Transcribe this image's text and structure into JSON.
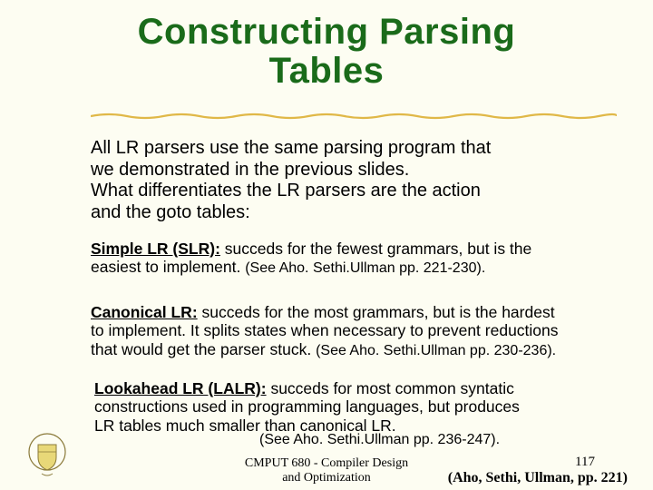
{
  "title_line1": "Constructing Parsing",
  "title_line2": "Tables",
  "intro": {
    "l1": "All LR parsers use the same parsing program that",
    "l2": "we demonstrated in the previous slides.",
    "l3": "What differentiates the LR parsers are the action",
    "l4": "and the goto tables:"
  },
  "slr": {
    "label": "Simple LR (SLR):",
    "text1": " succeds for the fewest grammars, but is the",
    "text2": "easiest to implement.  ",
    "ref": "(See Aho. Sethi.Ullman pp. 221-230)."
  },
  "canonical": {
    "label": "Canonical LR:",
    "text1": " succeds for the most grammars, but is the hardest",
    "text2": "to implement. It splits states when necessary to prevent reductions",
    "text3": "that would get the parser stuck. ",
    "ref": "(See Aho. Sethi.Ullman pp. 230-236)."
  },
  "lalr": {
    "label": "Lookahead LR (LALR):",
    "text1": " succeds for most common syntatic",
    "text2": "constructions used in programming languages, but produces",
    "text3": "LR tables much smaller than canonical LR.",
    "ref": "(See Aho. Sethi.Ullman pp. 236-247)."
  },
  "footer": {
    "l1": "CMPUT 680 - Compiler Design",
    "l2": "and Optimization"
  },
  "page_number": "117",
  "citation": "(Aho, Sethi, Ullman, pp. 221)"
}
